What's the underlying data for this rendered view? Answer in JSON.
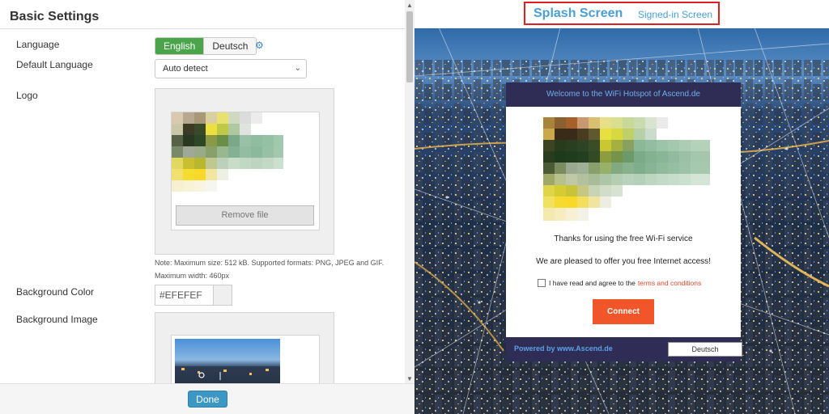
{
  "settings": {
    "title": "Basic Settings",
    "language_label": "Language",
    "language_options": [
      "English",
      "Deutsch"
    ],
    "language_selected": "English",
    "default_language_label": "Default Language",
    "default_language_value": "Auto detect",
    "logo_label": "Logo",
    "remove_file_label": "Remove file",
    "logo_note": "Note: Maximum size: 512 kB. Supported formats: PNG, JPEG and GIF. Maximum width: 460px",
    "background_color_label": "Background Color",
    "background_color_value": "#EFEFEF",
    "background_image_label": "Background Image",
    "done_label": "Done"
  },
  "preview": {
    "tabs": [
      "Splash Screen",
      "Signed-in Screen"
    ],
    "active_tab": "Splash Screen",
    "card": {
      "header": "Welcome to the WiFi Hotspot of Ascend.de",
      "thanks_text": "Thanks for using the free Wi-Fi service",
      "offer_text": "We are pleased to offer you free Internet access!",
      "agree_text": "I have read and agree to the",
      "terms_link": "terms and conditions",
      "connect_label": "Connect",
      "powered_by": "Powered by www.Ascend.de",
      "language_button": "Deutsch"
    }
  },
  "icons": {
    "language_settings": "gear-icon",
    "select_caret": "chevron-down-icon",
    "scroll_up": "arrow-up-icon",
    "scroll_down": "arrow-down-icon"
  },
  "colors": {
    "accent_green": "#4aa54a",
    "done_blue": "#3d97c3",
    "tab_blue": "#4a9fd6",
    "highlight_red": "#e02020",
    "card_band": "#2f2c56",
    "connect_orange": "#f0562a",
    "terms_link": "#e0482b"
  }
}
